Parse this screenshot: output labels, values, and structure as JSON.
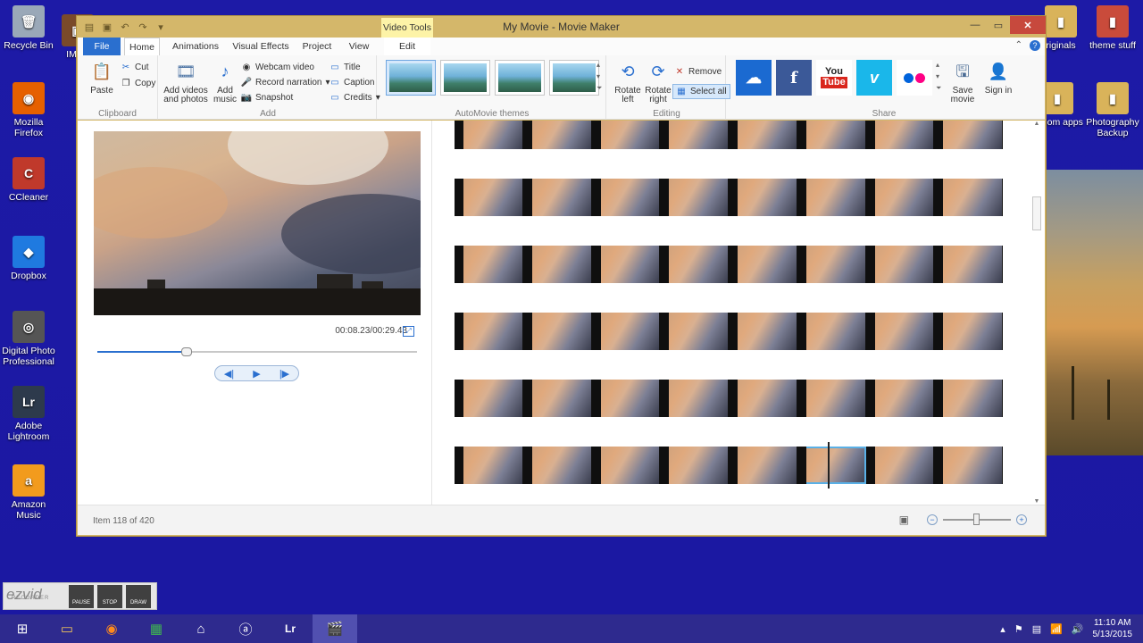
{
  "desktop": {
    "icons": [
      {
        "label": "Recycle Bin",
        "glyph": "🗑",
        "color": "#9aa8b8"
      },
      {
        "label": "IMG_",
        "glyph": "▣",
        "color": "#7a4a2a"
      },
      {
        "label": "Mozilla Firefox",
        "glyph": "◉",
        "color": "#e66000"
      },
      {
        "label": "CCleaner",
        "glyph": "C",
        "color": "#c0392b"
      },
      {
        "label": "Dropbox",
        "glyph": "◆",
        "color": "#1f7ae0"
      },
      {
        "label": "Digital Photo Professional",
        "glyph": "◎",
        "color": "#555"
      },
      {
        "label": "Adobe Lightroom",
        "glyph": "Lr",
        "color": "#2d3a4c"
      },
      {
        "label": "Amazon Music",
        "glyph": "a",
        "color": "#f29b1d"
      }
    ],
    "right_icons": [
      {
        "label": "riginals",
        "glyph": "▮",
        "color": "#d9b35a"
      },
      {
        "label": "theme stuff",
        "glyph": "▮",
        "color": "#c94b3b"
      },
      {
        "label": "andom apps",
        "glyph": "▮",
        "color": "#d9b35a"
      },
      {
        "label": "Photography Backup",
        "glyph": "▮",
        "color": "#d9b35a"
      }
    ]
  },
  "window": {
    "title": "My Movie - Movie Maker",
    "contextual_tab": "Video Tools"
  },
  "ribbon": {
    "tabs": [
      "File",
      "Home",
      "Animations",
      "Visual Effects",
      "Project",
      "View",
      "Edit"
    ],
    "clipboard": {
      "paste": "Paste",
      "cut": "Cut",
      "copy": "Copy",
      "label": "Clipboard"
    },
    "add": {
      "add_videos": "Add videos and photos",
      "add_music": "Add music",
      "webcam": "Webcam video",
      "narration": "Record narration",
      "snapshot": "Snapshot",
      "title": "Title",
      "caption": "Caption",
      "credits": "Credits",
      "label": "Add"
    },
    "themes_label": "AutoMovie themes",
    "editing": {
      "rotate_left": "Rotate left",
      "rotate_right": "Rotate right",
      "remove": "Remove",
      "select_all": "Select all",
      "label": "Editing"
    },
    "share": {
      "save_movie": "Save movie",
      "sign_in": "Sign in",
      "label": "Share"
    }
  },
  "preview": {
    "timecode": "00:08.23/00:29.43",
    "progress": 0.28
  },
  "storyboard": {
    "rows": 6,
    "frames_per_row": 8,
    "selected_row": 5,
    "selected_frame": 5
  },
  "status": {
    "text": "Item 118 of 420",
    "zoom": 0.45
  },
  "ezvid": {
    "logo": "ezvid",
    "sub": "RECORDER",
    "buttons": [
      "PAUSE",
      "STOP",
      "DRAW"
    ]
  },
  "taskbar": {
    "clock_time": "11:10 AM",
    "clock_date": "5/13/2015"
  }
}
